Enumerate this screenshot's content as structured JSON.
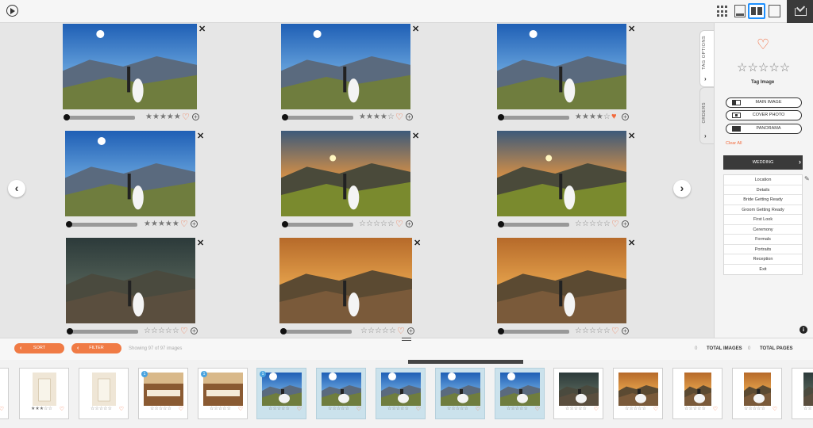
{
  "toolbar_top": {
    "play_icon": "play-circle-icon",
    "view_icons": [
      "grid-view-icon",
      "filmstrip-view-icon",
      "two-up-view-icon",
      "single-view-icon"
    ],
    "active_view": "two-up-view-icon",
    "download_icon": "download-box-icon"
  },
  "colors": {
    "accent": "#f07b45",
    "heart": "#f26a3c",
    "selected_view": "#1e90ff",
    "dark": "#3a3a3a",
    "film_selected": "#cbe2ec"
  },
  "grid": {
    "prev_label": "‹",
    "next_label": "›",
    "photos": [
      {
        "stars": 5,
        "liked": false,
        "close": "✕"
      },
      {
        "stars": 4,
        "liked": false,
        "close": "✕"
      },
      {
        "stars": 4,
        "liked": true,
        "close": "✕"
      },
      {
        "stars": 5,
        "liked": false,
        "close": "✕"
      },
      {
        "stars": 0,
        "liked": false,
        "close": "✕"
      },
      {
        "stars": 0,
        "liked": false,
        "close": "✕"
      },
      {
        "stars": 0,
        "liked": false,
        "close": "✕"
      },
      {
        "stars": 0,
        "liked": false,
        "close": "✕"
      },
      {
        "stars": 0,
        "liked": false,
        "close": "✕"
      }
    ]
  },
  "panel": {
    "tabs": [
      {
        "label": "TAG OPTIONS",
        "chevron": "›"
      },
      {
        "label": "ORDERS",
        "chevron": "›"
      }
    ],
    "heart": "♡",
    "stars": "☆☆☆☆☆",
    "tag_image": "Tag Image",
    "pills": [
      {
        "label": "MAIN IMAGE"
      },
      {
        "label": "COVER PHOTO"
      },
      {
        "label": "PANORAMA"
      }
    ],
    "clear_all": "Clear All",
    "wedding": "WEDDING",
    "wedding_chevron": "›",
    "edit": "✎",
    "info": "i",
    "categories": [
      "Location",
      "Details",
      "Bride Getting Ready",
      "Groom Getting Ready",
      "First Look",
      "Ceremony",
      "Formals",
      "Portraits",
      "Reception",
      "Exit"
    ]
  },
  "bottom": {
    "sort": "SORT",
    "filter": "FILTER",
    "chevron": "‹",
    "showing": "Showing 97 of 97 images",
    "total_images_count": "0",
    "total_images_label": "TOTAL IMAGES",
    "total_pages_count": "0",
    "total_pages_label": "TOTAL PAGES"
  },
  "filmstrip": [
    {
      "stars": "☆",
      "heart": "♡",
      "selected": false,
      "badge": ""
    },
    {
      "stars": "★★★☆☆",
      "heart": "♡",
      "selected": false,
      "badge": ""
    },
    {
      "stars": "☆☆☆☆☆",
      "heart": "♡",
      "selected": false,
      "badge": ""
    },
    {
      "stars": "☆☆☆☆☆",
      "heart": "♡",
      "selected": false,
      "badge": "1"
    },
    {
      "stars": "☆☆☆☆☆",
      "heart": "♡",
      "selected": false,
      "badge": "1"
    },
    {
      "stars": "☆☆☆☆☆",
      "heart": "♡",
      "selected": true,
      "badge": "1"
    },
    {
      "stars": "☆☆☆☆☆",
      "heart": "♡",
      "selected": true,
      "badge": ""
    },
    {
      "stars": "☆☆☆☆☆",
      "heart": "♡",
      "selected": true,
      "badge": ""
    },
    {
      "stars": "☆☆☆☆☆",
      "heart": "♡",
      "selected": true,
      "badge": ""
    },
    {
      "stars": "☆☆☆☆☆",
      "heart": "♡",
      "selected": true,
      "badge": ""
    },
    {
      "stars": "☆☆☆☆☆",
      "heart": "♡",
      "selected": false,
      "badge": ""
    },
    {
      "stars": "☆☆☆☆☆",
      "heart": "♡",
      "selected": false,
      "badge": ""
    },
    {
      "stars": "☆☆☆☆☆",
      "heart": "♡",
      "selected": false,
      "badge": ""
    },
    {
      "stars": "☆☆☆☆☆",
      "heart": "♡",
      "selected": false,
      "badge": ""
    },
    {
      "stars": "☆☆",
      "heart": "♡",
      "selected": false,
      "badge": ""
    }
  ]
}
